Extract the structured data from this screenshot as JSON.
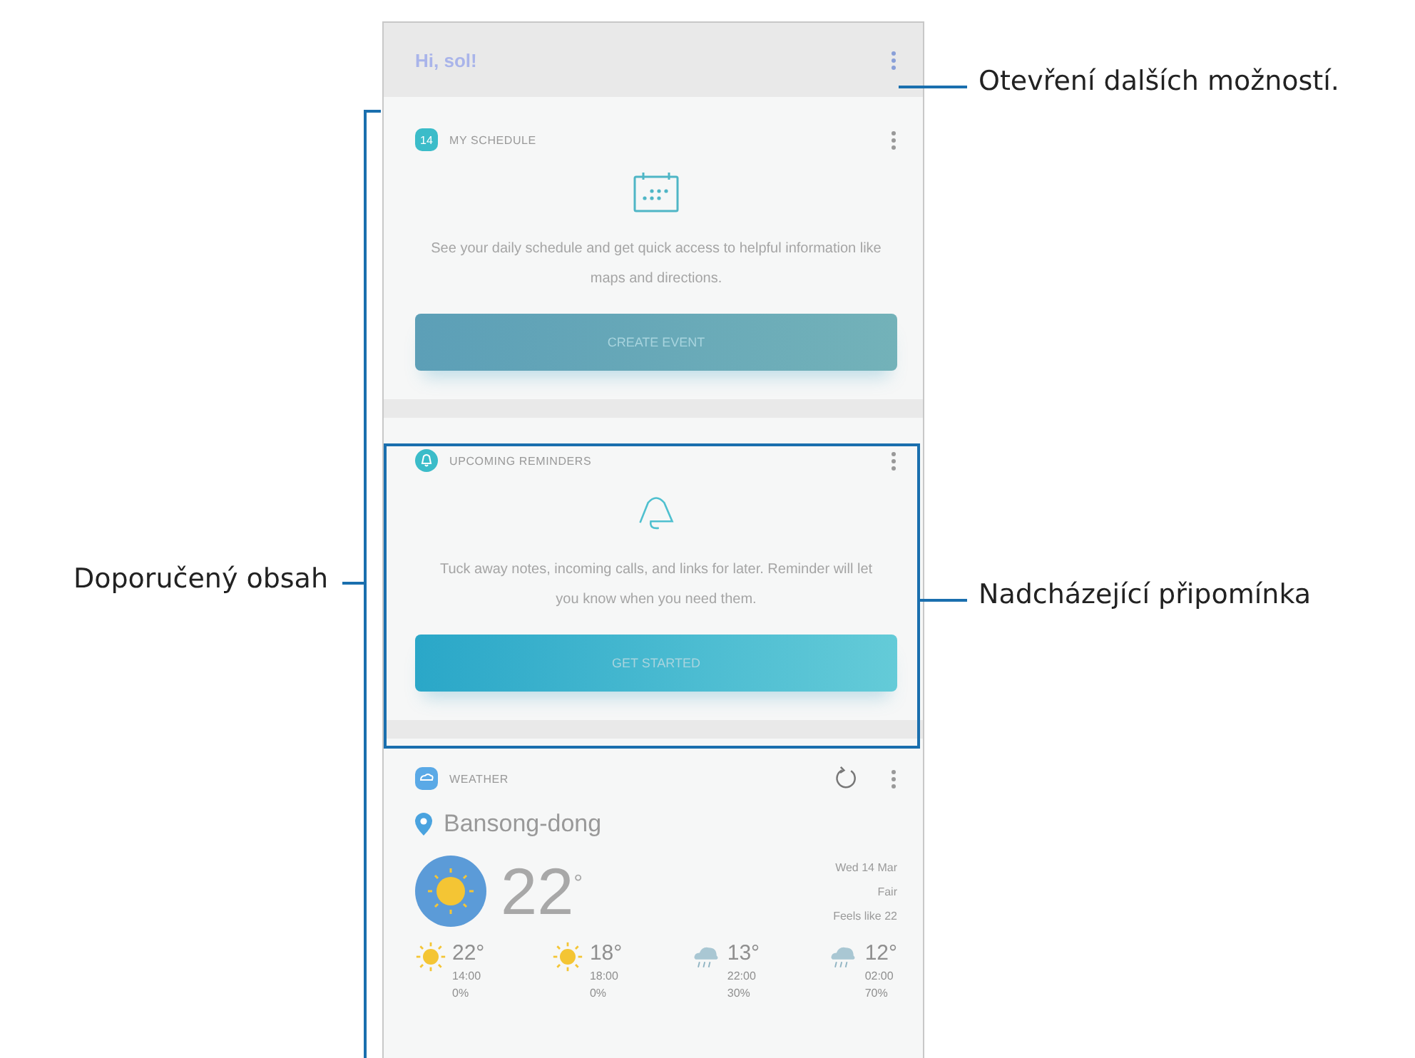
{
  "callouts": [
    {
      "kind": "right",
      "text": "Otevření dalších možností."
    },
    {
      "kind": "left",
      "text": "Doporučený obsah"
    },
    {
      "kind": "right-box",
      "text": "Nadcházející připomínka"
    }
  ],
  "header": {
    "greeting": "Hi, sol!"
  },
  "cards": [
    {
      "kind": "schedule",
      "title": "MY SCHEDULE",
      "icon_text": "14",
      "description": "See your daily schedule and get quick access to helpful information like maps and directions.",
      "button": "CREATE EVENT"
    },
    {
      "kind": "reminder",
      "title": "UPCOMING REMINDERS",
      "description": "Tuck away notes, incoming calls, and links for later. Reminder will let you know when you need them.",
      "button": "GET STARTED"
    },
    {
      "kind": "weather",
      "title": "WEATHER",
      "location": "Bansong-dong",
      "temperature": "22",
      "degree": "°",
      "date": "Wed 14 Mar",
      "condition": "Fair",
      "feels_like": "Feels like 22",
      "forecast": [
        {
          "kind": "sunny",
          "temp": "22°",
          "time": "14:00",
          "chance": "0%"
        },
        {
          "kind": "sunny",
          "temp": "18°",
          "time": "18:00",
          "chance": "0%"
        },
        {
          "kind": "rain",
          "temp": "13°",
          "time": "22:00",
          "chance": "30%"
        },
        {
          "kind": "rain",
          "temp": "12°",
          "time": "02:00",
          "chance": "70%"
        }
      ]
    }
  ]
}
